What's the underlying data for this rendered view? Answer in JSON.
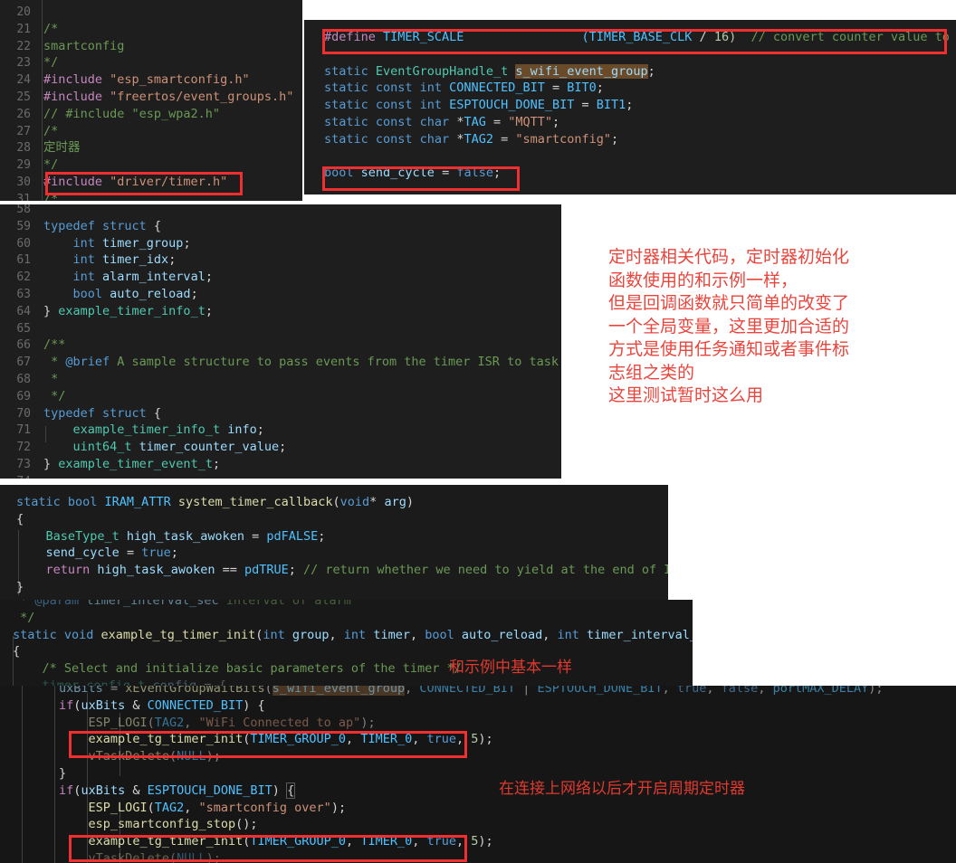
{
  "meta": {
    "kind": "code-editor-screenshot-collage",
    "background": "#ffffff",
    "editor_background": "#1e1e1e",
    "annotation_color": "#f03030",
    "note_color": "#e8453c"
  },
  "block1": {
    "name": "top-left-includes-block",
    "lines": [
      {
        "no": "20",
        "text": ""
      },
      {
        "no": "21",
        "text": "/*"
      },
      {
        "no": "22",
        "text": "smartconfig"
      },
      {
        "no": "23",
        "text": "*/"
      },
      {
        "no": "24",
        "text": "#include \"esp_smartconfig.h\""
      },
      {
        "no": "25",
        "text": "#include \"freertos/event_groups.h\""
      },
      {
        "no": "26",
        "text": "// #include \"esp_wpa2.h\""
      },
      {
        "no": "27",
        "text": "/*"
      },
      {
        "no": "28",
        "text": "定时器"
      },
      {
        "no": "29",
        "text": "*/"
      },
      {
        "no": "30",
        "text": "#include \"driver/timer.h\""
      },
      {
        "no": "31",
        "text": "/*"
      }
    ],
    "highlight_line": "#include \"driver/timer.h\""
  },
  "block2": {
    "name": "top-right-defines-block",
    "lines": [
      {
        "text": "#define TIMER_SCALE            (TIMER_BASE_CLK / 16)  // convert counter value to seconds"
      },
      {
        "text": ""
      },
      {
        "text": "static EventGroupHandle_t s_wifi_event_group;"
      },
      {
        "text": "static const int CONNECTED_BIT = BIT0;"
      },
      {
        "text": "static const int ESPTOUCH_DONE_BIT = BIT1;"
      },
      {
        "text": "static const char *TAG = \"MQTT\";"
      },
      {
        "text": "static const char *TAG2 = \"smartconfig\";"
      },
      {
        "text": ""
      },
      {
        "text": "bool send_cycle = false;"
      }
    ],
    "highlights": [
      "#define TIMER_SCALE            (TIMER_BASE_CLK / 16)  // convert counter value to seconds",
      "bool send_cycle = false;"
    ],
    "selection": "s_wifi_event_group"
  },
  "block3": {
    "name": "typedef-structs-block",
    "lines": [
      {
        "no": "58",
        "text": ""
      },
      {
        "no": "59",
        "text": "typedef struct {"
      },
      {
        "no": "60",
        "text": "    int timer_group;"
      },
      {
        "no": "61",
        "text": "    int timer_idx;"
      },
      {
        "no": "62",
        "text": "    int alarm_interval;"
      },
      {
        "no": "63",
        "text": "    bool auto_reload;"
      },
      {
        "no": "64",
        "text": "} example_timer_info_t;"
      },
      {
        "no": "65",
        "text": ""
      },
      {
        "no": "66",
        "text": "/**"
      },
      {
        "no": "67",
        "text": " * @brief A sample structure to pass events from the timer ISR to task"
      },
      {
        "no": "68",
        "text": " *"
      },
      {
        "no": "69",
        "text": " */"
      },
      {
        "no": "70",
        "text": "typedef struct {"
      },
      {
        "no": "71",
        "text": "    example_timer_info_t info;"
      },
      {
        "no": "72",
        "text": "    uint64_t timer_counter_value;"
      },
      {
        "no": "73",
        "text": "} example_timer_event_t;"
      },
      {
        "no": "74",
        "text": ""
      }
    ]
  },
  "block4": {
    "name": "timer-callback-block",
    "lines": [
      {
        "text": "static bool IRAM_ATTR system_timer_callback(void* arg)"
      },
      {
        "text": "{"
      },
      {
        "text": "    BaseType_t high_task_awoken = pdFALSE;"
      },
      {
        "text": "    send_cycle = true;"
      },
      {
        "text": "    return high_task_awoken == pdTRUE; // return whether we need to yield at the end of ISR"
      },
      {
        "text": "}"
      }
    ]
  },
  "block5": {
    "name": "timer-init-block",
    "lines": [
      {
        "text": " * @param timer_interval_sec interval of alarm"
      },
      {
        "text": " */"
      },
      {
        "text": "static void example_tg_timer_init(int group, int timer, bool auto_reload, int timer_interval_sec)"
      },
      {
        "text": "{"
      },
      {
        "text": "    /* Select and initialize basic parameters of the timer */"
      },
      {
        "text": "    timer_config_t config = {"
      }
    ],
    "note": "和示例中基本一样"
  },
  "block6": {
    "name": "smartconfig-task-block",
    "lines": [
      {
        "text": "        uxBits = xEventGroupWaitBits(s_wifi_event_group, CONNECTED_BIT | ESPTOUCH_DONE_BIT, true, false, portMAX_DELAY);"
      },
      {
        "text": "        if(uxBits & CONNECTED_BIT) {"
      },
      {
        "text": "            ESP_LOGI(TAG2, \"WiFi Connected to ap\");"
      },
      {
        "text": "            example_tg_timer_init(TIMER_GROUP_0, TIMER_0, true, 5);"
      },
      {
        "text": "            vTaskDelete(NULL);"
      },
      {
        "text": "        }"
      },
      {
        "text": "        if(uxBits & ESPTOUCH_DONE_BIT) {"
      },
      {
        "text": "            ESP_LOGI(TAG2, \"smartconfig over\");"
      },
      {
        "text": "            esp_smartconfig_stop();"
      },
      {
        "text": "            example_tg_timer_init(TIMER_GROUP_0, TIMER_0, true, 5);"
      },
      {
        "text": "            vTaskDelete(NULL);"
      }
    ],
    "highlights": [
      "example_tg_timer_init(TIMER_GROUP_0, TIMER_0, true, 5);",
      "example_tg_timer_init(TIMER_GROUP_0, TIMER_0, true, 5);"
    ],
    "selection": "s_wifi_event_group",
    "note": "在连接上网络以后才开启周期定时器"
  },
  "notes": {
    "right_block": "定时器相关代码，定时器初始化\n函数使用的和示例一样，\n但是回调函数就只简单的改变了\n一个全局变量，这里更加合适的\n方式是使用任务通知或者事件标\n志组之类的\n这里测试暂时这么用",
    "mid_note": "和示例中基本一样",
    "bottom_note": "在连接上网络以后才开启周期定时器"
  }
}
